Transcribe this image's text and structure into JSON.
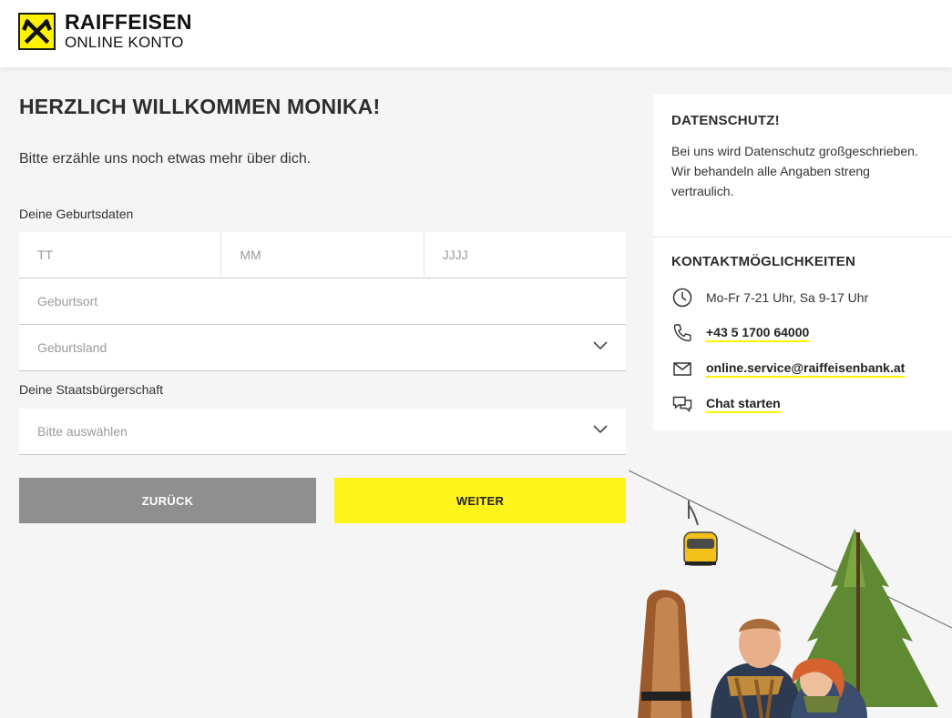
{
  "brand": {
    "name": "RAIFFEISEN",
    "product": "ONLINE KONTO",
    "colors": {
      "accent": "#fff200",
      "button_back": "#8f8f8f",
      "button_next": "#fff31a"
    }
  },
  "main": {
    "title": "HERZLICH WILLKOMMEN MONIKA!",
    "intro": "Bitte erzähle uns noch etwas mehr über dich.",
    "birth_section_label": "Deine Geburtsdaten",
    "birth_day_placeholder": "TT",
    "birth_month_placeholder": "MM",
    "birth_year_placeholder": "JJJJ",
    "birthplace_placeholder": "Geburtsort",
    "birthcountry_placeholder": "Geburtsland",
    "citizenship_label": "Deine Staatsbürgerschaft",
    "citizenship_placeholder": "Bitte auswählen",
    "back_label": "ZURÜCK",
    "next_label": "WEITER"
  },
  "sidebar": {
    "privacy_title": "DATENSCHUTZ!",
    "privacy_text": "Bei uns wird Datenschutz großgeschrieben. Wir behandeln alle Angaben streng vertraulich.",
    "contact_title": "KONTAKTMÖGLICHKEITEN",
    "hours": "Mo-Fr 7-21 Uhr, Sa 9-17 Uhr",
    "phone": "+43 5 1700 64000",
    "email": "online.service@raiffeisenbank.at",
    "chat": "Chat starten",
    "icons": [
      "clock-icon",
      "phone-icon",
      "mail-icon",
      "chat-icon"
    ]
  }
}
